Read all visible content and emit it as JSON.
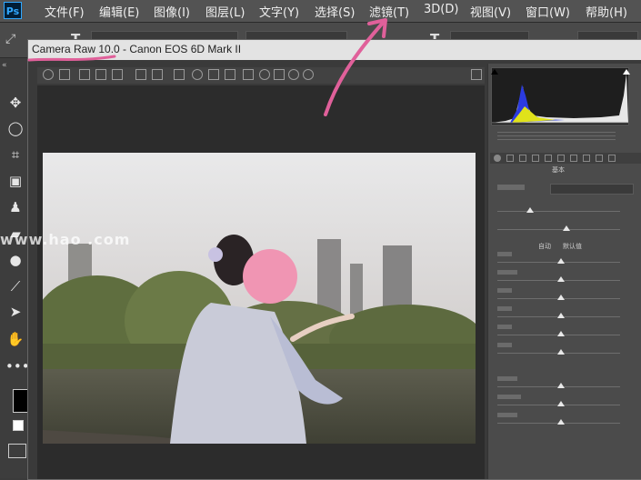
{
  "app": {
    "logo": "Ps"
  },
  "menu": [
    {
      "label": "文件(F)"
    },
    {
      "label": "编辑(E)"
    },
    {
      "label": "图像(I)"
    },
    {
      "label": "图层(L)"
    },
    {
      "label": "文字(Y)"
    },
    {
      "label": "选择(S)"
    },
    {
      "label": "滤镜(T)"
    },
    {
      "label": "3D(D)"
    },
    {
      "label": "视图(V)"
    },
    {
      "label": "窗口(W)"
    },
    {
      "label": "帮助(H)"
    }
  ],
  "camera_raw": {
    "title_app": "Camera Raw 10.0",
    "title_sep": " - ",
    "title_camera": "Canon EOS 6D Mark II"
  },
  "panel": {
    "section_label": "基本",
    "mode_labels": [
      "自动",
      "默认值"
    ]
  },
  "watermark": "www.hao     .com",
  "colors": {
    "accent_blue": "#31a8ff",
    "annotation_pink": "#e0609a",
    "titlebar": "#e3e3e3"
  }
}
